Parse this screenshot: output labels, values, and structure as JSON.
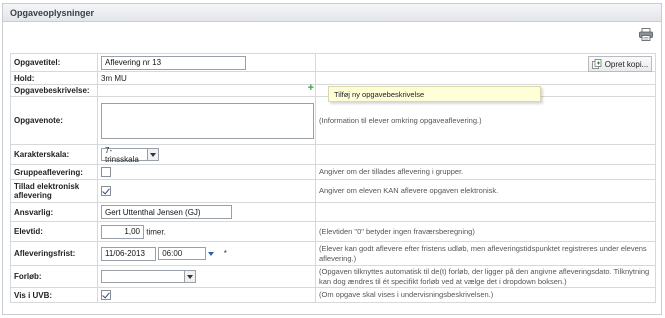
{
  "panel": {
    "title": "Opgaveoplysninger"
  },
  "toolbar": {
    "print_icon": "printer-icon"
  },
  "fields": {
    "title": {
      "label": "Opgavetitel:",
      "value": "Aflevering nr 13",
      "copy_button": "Opret kopi..."
    },
    "team": {
      "label": "Hold:",
      "value": "3m MU"
    },
    "description": {
      "label": "Opgavebeskrivelse:",
      "tooltip": "Tilføj ny opgavebeskrivelse"
    },
    "note": {
      "label": "Opgavenote:",
      "value": "",
      "help": "(Information til elever omkring opgaveaflevering.)"
    },
    "grade_scale": {
      "label": "Karakterskala:",
      "value": "7-trinsskala"
    },
    "group": {
      "label": "Gruppeaflevering:",
      "checked": false,
      "help": "Angiver om der tillades aflevering i grupper."
    },
    "electronic": {
      "label": "Tillad elektronisk aflevering",
      "checked": true,
      "help": "Angiver om eleven KAN aflevere opgaven elektronisk."
    },
    "responsible": {
      "label": "Ansvarlig:",
      "value": "Gert Uttenthal Jensen (GJ)"
    },
    "student_time": {
      "label": "Elevtid:",
      "value": "1,00",
      "unit": "timer.",
      "help": "(Elevtiden \"0\" betyder ingen fraværsberegning)"
    },
    "deadline": {
      "label": "Afleveringsfrist:",
      "date": "11/06-2013",
      "time": "06:00",
      "required_mark": "*",
      "help": "(Elever kan godt aflevere efter fristens udløb, men afleveringstidspunktet registreres under elevens aflevering.)"
    },
    "course": {
      "label": "Forløb:",
      "value": "",
      "help": "(Opgaven tilknyttes automatisk til de(t) forløb, der ligger på den angivne afleveringsdato. Tilknytning kan dog ændres til ét specifikt forløb ved at vælge det i dropdown boksen.)"
    },
    "show_uvb": {
      "label": "Vis i UVB:",
      "checked": true,
      "help": "(Om opgave skal vises i undervisningsbeskrivelsen.)"
    }
  }
}
